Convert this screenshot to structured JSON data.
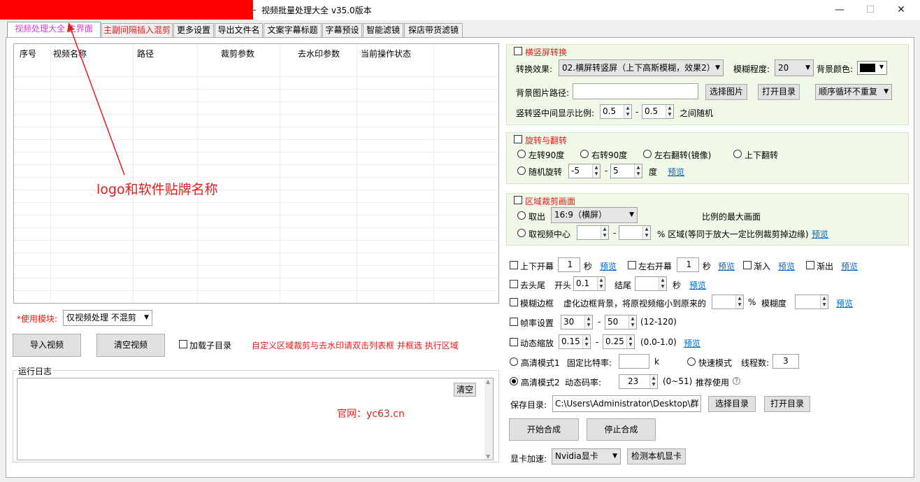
{
  "window": {
    "title": "视频批量处理大全  v35.0版本",
    "title_dash": "-",
    "minimize": "—",
    "maximize": "☐",
    "close": "✕"
  },
  "tabs": [
    "视频处理大全",
    "主界面",
    "主副间隔插入混剪",
    "更多设置",
    "导出文件名",
    "文案字幕标题",
    "字幕预设",
    "智能滤镜",
    "探店带货滤镜"
  ],
  "list": {
    "columns": [
      "序号",
      "视频名称",
      "路径",
      "裁剪参数",
      "去水印参数",
      "当前操作状态"
    ]
  },
  "annotation": {
    "logo_note": "logo和软件贴牌名称",
    "website": "官网：yc63.cn"
  },
  "left": {
    "module_label": "*使用模块:",
    "module_value": "仅视频处理 不混剪",
    "import_btn": "导入视频",
    "clear_btn": "清空视频",
    "subdir_label": "加载子目录",
    "hint": "自定义区域裁剪与去水印请双击列表框 并框选 执行区域",
    "log_title": "运行日志",
    "log_clear": "清空"
  },
  "hv": {
    "title": "横竖屏转换",
    "effect_label": "转换效果:",
    "effect_value": "02.横屏转竖屏（上下高斯模糊，效果2）",
    "blur_label": "模糊程度:",
    "blur_value": "20",
    "bgcolor_label": "背景颜色:",
    "bgcolor_value": "#000000",
    "bgpath_label": "背景图片路径:",
    "bgpath_value": "",
    "select_img": "选择图片",
    "open_dir": "打开目录",
    "order_value": "顺序循环不重复",
    "ratio_label": "竖转竖中间显示比例:",
    "ratio_a": "0.5",
    "ratio_b": "0.5",
    "ratio_sep": "-",
    "ratio_tail": "之间随机"
  },
  "rotate": {
    "title": "旋转与翻转",
    "r90l": "左转90度",
    "r90r": "右转90度",
    "mirror": "左右翻转(镜像)",
    "flipud": "上下翻转",
    "random": "随机旋转",
    "rand_a": "-5",
    "rand_sep": "-",
    "rand_b": "5",
    "unit": "度",
    "preview": "预览"
  },
  "crop": {
    "title": "区域裁剪画面",
    "take": "取出",
    "ratio_value": "16:9（横屏）",
    "max_label": "比例的最大画面",
    "center": "取视频中心",
    "c_a": "",
    "c_sep": "-",
    "c_b": "",
    "center_tail": "% 区域(等同于放大一定比例裁剪掉边缘)",
    "preview": "预览"
  },
  "opts": {
    "tb_open": "上下开幕",
    "tb_val": "1",
    "sec": "秒",
    "preview": "预览",
    "lr_open": "左右开幕",
    "lr_val": "1",
    "fadein": "渐入",
    "fadeout": "渐出",
    "trim": "去头尾",
    "head": "开头",
    "head_val": "0.1",
    "tail": "结尾",
    "tail_val": "",
    "blur_border": "模糊边框",
    "blur_desc": "虚化边框背景，将原视频缩小到原来的",
    "blur_scale": "",
    "percent": "%",
    "blur_deg": "模糊度",
    "blur_deg_val": "",
    "fps": "帧率设置",
    "fps_a": "30",
    "fps_sep": "-",
    "fps_b": "50",
    "fps_range": "(12-120)",
    "zoom": "动态缩放",
    "zoom_a": "0.15",
    "zoom_sep": "-",
    "zoom_b": "0.25",
    "zoom_range": "(0.0-1.0)",
    "hq1": "高清模式1",
    "fixed_rate": "固定比特率:",
    "fixed_val": "",
    "k": "k",
    "fast": "快速模式",
    "threads": "线程数:",
    "threads_val": "3",
    "hq2": "高清模式2",
    "dyn_rate": "动态码率:",
    "dyn_val": "23",
    "dyn_range": "(0~51)",
    "recommend": "推荐使用",
    "help": "?",
    "save_label": "保存目录:",
    "save_path": "C:\\Users\\Administrator\\Desktop\\群",
    "select_dir": "选择目录",
    "open_dir": "打开目录",
    "start": "开始合成",
    "stop": "停止合成",
    "gpu_label": "显卡加速:",
    "gpu_value": "Nvidia显卡",
    "gpu_detect": "检测本机显卡"
  }
}
